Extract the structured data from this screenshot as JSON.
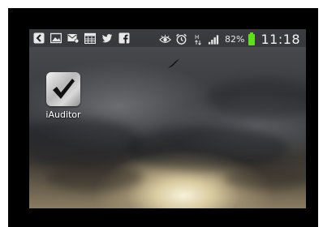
{
  "status_bar": {
    "battery_percent": "82%",
    "time": "11:18",
    "signal_strength_bars": 4,
    "network_type": "H",
    "notification_icons": [
      "back-arrow-notification-icon",
      "image-notification-icon",
      "messaging-notification-icon",
      "calendar-notification-icon",
      "twitter-icon",
      "facebook-icon"
    ],
    "system_icons": [
      "smart-stay-eye-icon",
      "alarm-icon",
      "data-transfer-icon",
      "signal-icon",
      "battery-icon"
    ],
    "battery_color": "#5fe01a"
  },
  "home_screen": {
    "apps": [
      {
        "label": "iAuditor",
        "icon": "checkmark-icon"
      }
    ]
  }
}
